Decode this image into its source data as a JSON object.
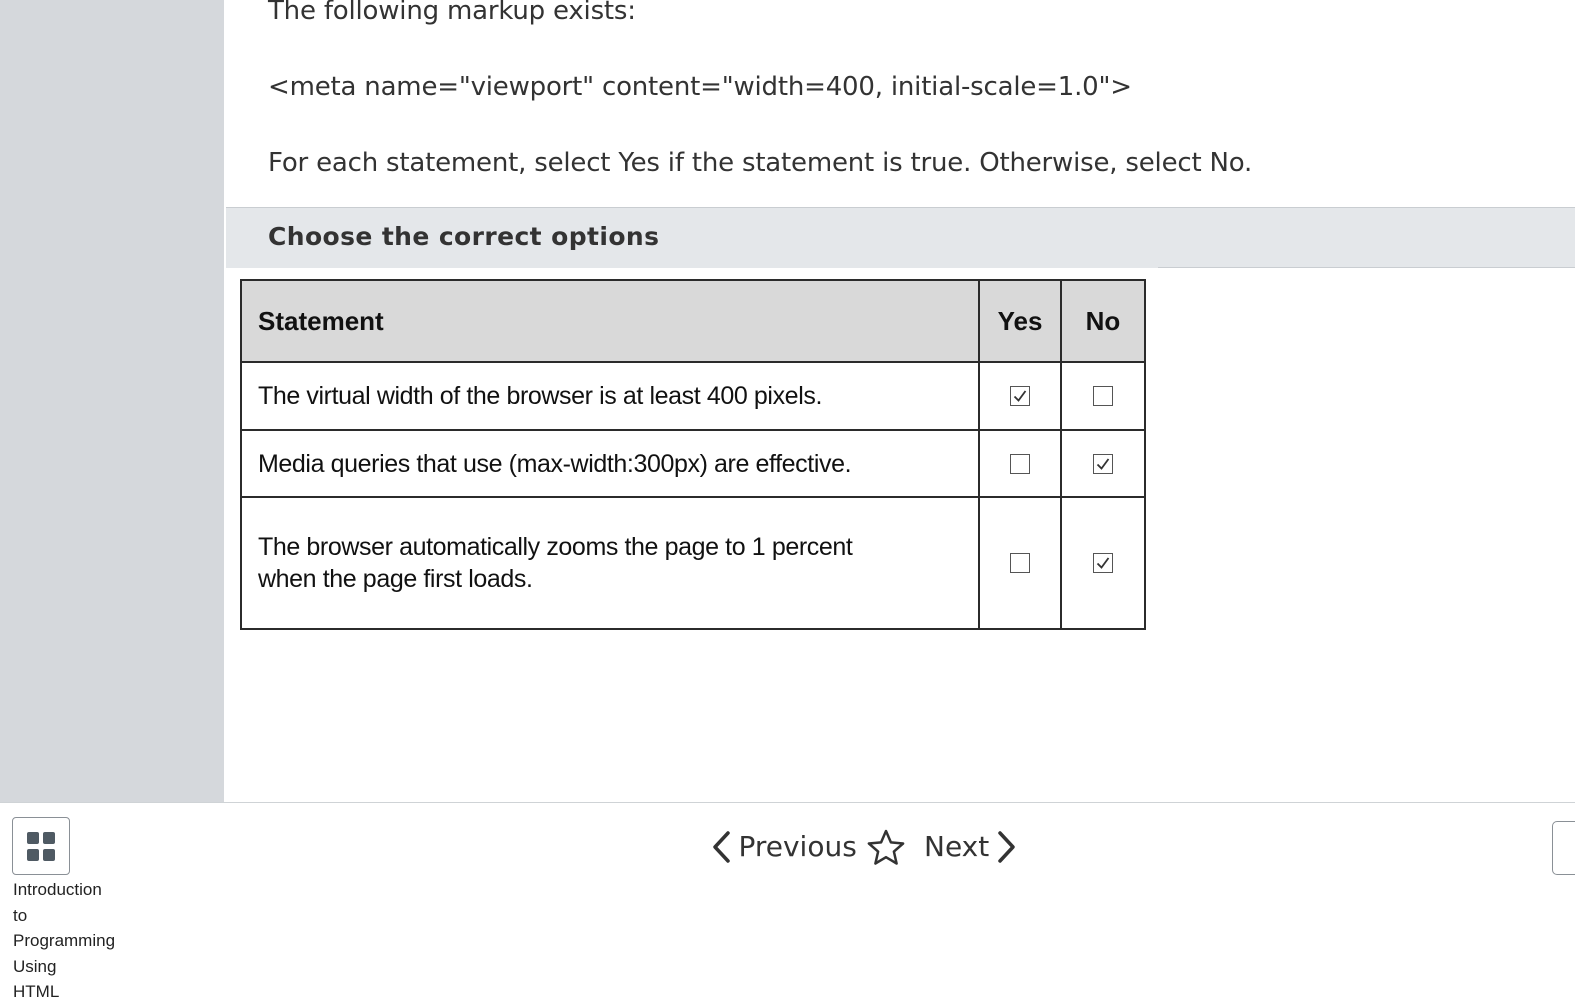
{
  "question": {
    "line1": "The following markup exists:",
    "code": "<meta name=\"viewport\" content=\"width=400, initial-scale=1.0\">",
    "instruction": "For each statement, select Yes if the statement is true. Otherwise, select No."
  },
  "section_header": "Choose the correct options",
  "answer_table": {
    "headers": [
      "Statement",
      "Yes",
      "No"
    ],
    "rows": [
      {
        "statement": "The virtual width of the browser is at least 400 pixels.",
        "yes": true,
        "no": false
      },
      {
        "statement": "Media queries that use (max-width:300px) are effective.",
        "yes": false,
        "no": true
      },
      {
        "statement_line1": "The browser automatically zooms the page to 1 percent",
        "statement_line2": "when the page first loads.",
        "yes": false,
        "no": true
      }
    ]
  },
  "footer": {
    "course_title_lines": [
      "Introduction",
      "to",
      "Programming",
      "Using",
      "HTML"
    ],
    "previous_label": "Previous",
    "next_label": "Next",
    "icons": {
      "menu": "grid-icon",
      "prev": "chevron-left-icon",
      "next": "chevron-right-icon",
      "bookmark": "star-icon"
    }
  }
}
